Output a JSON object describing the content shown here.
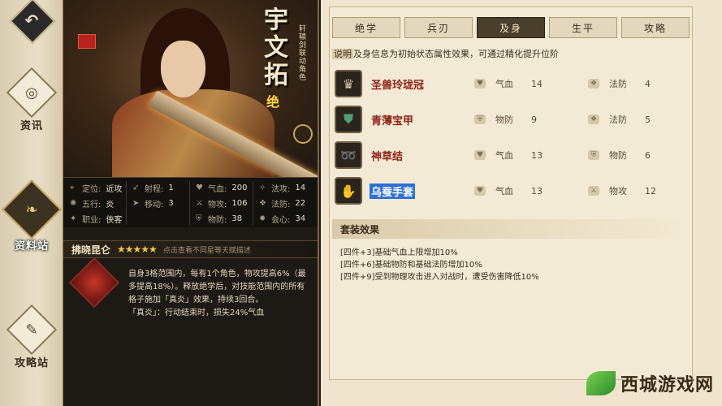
{
  "nav": {
    "back_icon": "back-arrow-icon",
    "items": [
      {
        "label": "资讯",
        "icon": "scroll-icon"
      },
      {
        "label": "资料站",
        "icon": "book-icon",
        "active": true
      },
      {
        "label": "攻略站",
        "icon": "quill-icon"
      }
    ]
  },
  "character": {
    "name": "宇文拓",
    "subtitle": "轩辕剑联动角色",
    "mark": "绝",
    "stats": [
      {
        "label": "定位:",
        "value": "近攻",
        "icon": "location-icon"
      },
      {
        "label": "射程:",
        "value": "1",
        "icon": "range-icon"
      },
      {
        "label": "五行:",
        "value": "炎",
        "icon": "element-icon"
      },
      {
        "label": "移动:",
        "value": "3",
        "icon": "move-icon"
      },
      {
        "label": "职业:",
        "value": "侠客",
        "icon": "class-icon"
      },
      {
        "label": "气血:",
        "value": "200",
        "icon": "heart-icon"
      },
      {
        "label": "法攻:",
        "value": "14",
        "icon": "magic-attack-icon"
      },
      {
        "label": "物攻:",
        "value": "106",
        "icon": "physical-attack-icon"
      },
      {
        "label": "法防:",
        "value": "22",
        "icon": "magic-defense-icon"
      },
      {
        "label": "物防:",
        "value": "38",
        "icon": "physical-defense-icon"
      },
      {
        "label": "会心:",
        "value": "34",
        "icon": "crit-icon"
      }
    ],
    "talent": {
      "name": "拂晓昆仑",
      "stars": "★★★★★",
      "hint": "点击查看不同星等天赋描述",
      "description": "自身3格范围内，每有1个角色，物攻提高6%（最多提高18%）。释放绝学后，对技能范围内的所有格子施加「真炎」效果，持续3回合。\n「真炎」：行动结束时，损失24%气血"
    }
  },
  "tabs": [
    {
      "label": "绝学"
    },
    {
      "label": "兵刃"
    },
    {
      "label": "及身",
      "active": true
    },
    {
      "label": "生平"
    },
    {
      "label": "攻略"
    }
  ],
  "intro": {
    "highlight": "说明",
    "text": "及身信息为初始状态属性效果，可通过精化提升位阶"
  },
  "equipment": [
    {
      "name": "圣兽玲珑冠",
      "attr1_name": "气血",
      "attr1_value": "14",
      "attr2_name": "法防",
      "attr2_value": "4"
    },
    {
      "name": "青薄宝甲",
      "attr1_name": "物防",
      "attr1_value": "9",
      "attr2_name": "法防",
      "attr2_value": "5"
    },
    {
      "name": "神草结",
      "attr1_name": "气血",
      "attr1_value": "13",
      "attr2_name": "物防",
      "attr2_value": "6"
    },
    {
      "name": "乌蚕手套",
      "attr1_name": "气血",
      "attr1_value": "13",
      "attr2_name": "物攻",
      "attr2_value": "12",
      "selected": true
    }
  ],
  "set_effect": {
    "title": "套装效果",
    "lines": [
      "[四件+3]基础气血上限增加10%",
      "[四件+6]基础物防和基础法防增加10%",
      "[四件+9]受到物理攻击进入对战时，遭受伤害降低10%"
    ]
  },
  "watermark": {
    "text": "西城游戏网"
  }
}
